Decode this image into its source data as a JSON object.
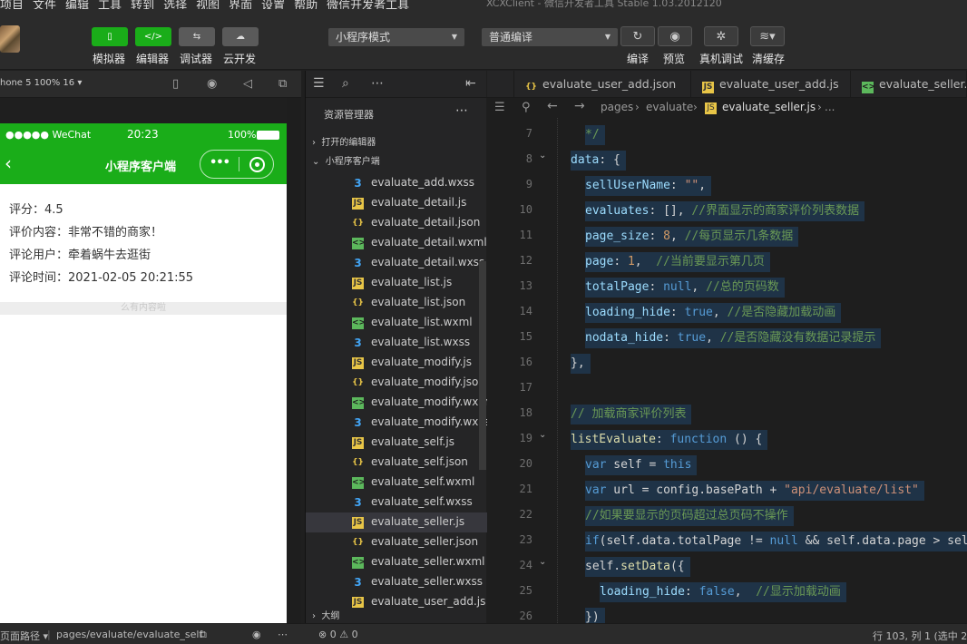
{
  "window": {
    "menus": [
      "项目",
      "文件",
      "编辑",
      "工具",
      "转到",
      "选择",
      "视图",
      "界面",
      "设置",
      "帮助",
      "微信开发者工具"
    ],
    "title": "XCXClient - 微信开发者工具 Stable 1.03.2012120"
  },
  "toolbar": {
    "buttons": [
      {
        "label": "模拟器",
        "glyph": "▯"
      },
      {
        "label": "编辑器",
        "glyph": "</>"
      },
      {
        "label": "调试器",
        "glyph": "⇆"
      },
      {
        "label": "云开发",
        "glyph": "☁"
      }
    ],
    "mode_select": "小程序模式",
    "compile_select": "普通编译",
    "right_buttons": [
      {
        "label": "编译",
        "glyph": "↻"
      },
      {
        "label": "预览",
        "glyph": "◉"
      },
      {
        "label": "真机调试",
        "glyph": "✲"
      },
      {
        "label": "清缓存",
        "glyph": "≋▾"
      }
    ]
  },
  "simulator": {
    "device": "hone 5 100% 16 ▾",
    "statusbar": {
      "carrier": "●●●●● WeChat",
      "time": "20:23",
      "battery": "100%"
    },
    "nav_title": "小程序客户端",
    "lines": [
      "评分：4.5",
      "评价内容：非常不错的商家！",
      "评论用户：牵着蜗牛去逛街",
      "评论时间：2021-02-05 20:21:55"
    ],
    "nodata": "么有内容啦"
  },
  "explorer": {
    "title": "资源管理器",
    "open_editors": "打开的编辑器",
    "project": "小程序客户端",
    "outline": "大纲",
    "files": [
      {
        "name": "evaluate_add.wxss",
        "type": "wxss"
      },
      {
        "name": "evaluate_detail.js",
        "type": "js"
      },
      {
        "name": "evaluate_detail.json",
        "type": "json"
      },
      {
        "name": "evaluate_detail.wxml",
        "type": "wxml"
      },
      {
        "name": "evaluate_detail.wxss",
        "type": "wxss"
      },
      {
        "name": "evaluate_list.js",
        "type": "js"
      },
      {
        "name": "evaluate_list.json",
        "type": "json"
      },
      {
        "name": "evaluate_list.wxml",
        "type": "wxml"
      },
      {
        "name": "evaluate_list.wxss",
        "type": "wxss"
      },
      {
        "name": "evaluate_modify.js",
        "type": "js"
      },
      {
        "name": "evaluate_modify.json",
        "type": "json"
      },
      {
        "name": "evaluate_modify.wxml",
        "type": "wxml"
      },
      {
        "name": "evaluate_modify.wxss",
        "type": "wxss"
      },
      {
        "name": "evaluate_self.js",
        "type": "js"
      },
      {
        "name": "evaluate_self.json",
        "type": "json"
      },
      {
        "name": "evaluate_self.wxml",
        "type": "wxml"
      },
      {
        "name": "evaluate_self.wxss",
        "type": "wxss"
      },
      {
        "name": "evaluate_seller.js",
        "type": "js",
        "active": true
      },
      {
        "name": "evaluate_seller.json",
        "type": "json"
      },
      {
        "name": "evaluate_seller.wxml",
        "type": "wxml"
      },
      {
        "name": "evaluate_seller.wxss",
        "type": "wxss"
      },
      {
        "name": "evaluate_user_add.js",
        "type": "js"
      }
    ]
  },
  "editor": {
    "tabs": [
      {
        "name": "evaluate_user_add.json",
        "type": "json"
      },
      {
        "name": "evaluate_user_add.js",
        "type": "js"
      },
      {
        "name": "evaluate_seller.wxml",
        "type": "wxml"
      }
    ],
    "breadcrumb": [
      "pages",
      "evaluate",
      "evaluate_seller.js",
      "..."
    ],
    "lines": [
      {
        "no": "7",
        "fold": "",
        "indent": 1,
        "tokens": [
          [
            "c",
            "*/"
          ]
        ]
      },
      {
        "no": "8",
        "fold": "⌄",
        "indent": 0,
        "tokens": [
          [
            "p",
            "data"
          ],
          [
            "o",
            ": {"
          ]
        ]
      },
      {
        "no": "9",
        "fold": "",
        "indent": 1,
        "tokens": [
          [
            "p",
            "sellUserName"
          ],
          [
            "o",
            ": "
          ],
          [
            "s",
            "\"\""
          ],
          [
            "o",
            ","
          ]
        ]
      },
      {
        "no": "10",
        "fold": "",
        "indent": 1,
        "tokens": [
          [
            "p",
            "evaluates"
          ],
          [
            "o",
            ": [], "
          ],
          [
            "c",
            "//界面显示的商家评价列表数据"
          ]
        ]
      },
      {
        "no": "11",
        "fold": "",
        "indent": 1,
        "tokens": [
          [
            "p",
            "page_size"
          ],
          [
            "o",
            ": "
          ],
          [
            "n",
            "8"
          ],
          [
            "o",
            ", "
          ],
          [
            "c",
            "//每页显示几条数据"
          ]
        ]
      },
      {
        "no": "12",
        "fold": "",
        "indent": 1,
        "tokens": [
          [
            "p",
            "page"
          ],
          [
            "o",
            ": "
          ],
          [
            "n",
            "1"
          ],
          [
            "o",
            ",  "
          ],
          [
            "c",
            "//当前要显示第几页"
          ]
        ]
      },
      {
        "no": "13",
        "fold": "",
        "indent": 1,
        "tokens": [
          [
            "p",
            "totalPage"
          ],
          [
            "o",
            ": "
          ],
          [
            "k",
            "null"
          ],
          [
            "o",
            ", "
          ],
          [
            "c",
            "//总的页码数"
          ]
        ]
      },
      {
        "no": "14",
        "fold": "",
        "indent": 1,
        "tokens": [
          [
            "p",
            "loading_hide"
          ],
          [
            "o",
            ": "
          ],
          [
            "k",
            "true"
          ],
          [
            "o",
            ", "
          ],
          [
            "c",
            "//是否隐藏加载动画"
          ]
        ]
      },
      {
        "no": "15",
        "fold": "",
        "indent": 1,
        "tokens": [
          [
            "p",
            "nodata_hide"
          ],
          [
            "o",
            ": "
          ],
          [
            "k",
            "true"
          ],
          [
            "o",
            ", "
          ],
          [
            "c",
            "//是否隐藏没有数据记录提示"
          ]
        ]
      },
      {
        "no": "16",
        "fold": "",
        "indent": 0,
        "tokens": [
          [
            "o",
            "},"
          ]
        ]
      },
      {
        "no": "17",
        "fold": "",
        "indent": 0,
        "tokens": []
      },
      {
        "no": "18",
        "fold": "",
        "indent": 0,
        "tokens": [
          [
            "c",
            "// 加载商家评价列表"
          ]
        ]
      },
      {
        "no": "19",
        "fold": "⌄",
        "indent": 0,
        "tokens": [
          [
            "f",
            "listEvaluate"
          ],
          [
            "o",
            ": "
          ],
          [
            "k",
            "function"
          ],
          [
            "o",
            " () {"
          ]
        ]
      },
      {
        "no": "20",
        "fold": "",
        "indent": 1,
        "tokens": [
          [
            "k",
            "var"
          ],
          [
            "o",
            " self = "
          ],
          [
            "k",
            "this"
          ]
        ]
      },
      {
        "no": "21",
        "fold": "",
        "indent": 1,
        "tokens": [
          [
            "k",
            "var"
          ],
          [
            "o",
            " url = config.basePath + "
          ],
          [
            "s",
            "\"api/evaluate/list\""
          ]
        ]
      },
      {
        "no": "22",
        "fold": "",
        "indent": 1,
        "tokens": [
          [
            "c",
            "//如果要显示的页码超过总页码不操作"
          ]
        ]
      },
      {
        "no": "23",
        "fold": "",
        "indent": 1,
        "tokens": [
          [
            "k",
            "if"
          ],
          [
            "o",
            "(self.data.totalPage != "
          ],
          [
            "k",
            "null"
          ],
          [
            "o",
            " && self.data.page > self"
          ]
        ]
      },
      {
        "no": "24",
        "fold": "⌄",
        "indent": 1,
        "tokens": [
          [
            "o",
            "self."
          ],
          [
            "f",
            "setData"
          ],
          [
            "o",
            "({"
          ]
        ]
      },
      {
        "no": "25",
        "fold": "",
        "indent": 2,
        "tokens": [
          [
            "p",
            "loading_hide"
          ],
          [
            "o",
            ": "
          ],
          [
            "k",
            "false"
          ],
          [
            "o",
            ",  "
          ],
          [
            "c",
            "//显示加载动画"
          ]
        ]
      },
      {
        "no": "26",
        "fold": "",
        "indent": 1,
        "tokens": [
          [
            "o",
            "})"
          ]
        ]
      }
    ]
  },
  "statusbar": {
    "path_label": "页面路径 ▾",
    "path": "pages/evaluate/evaluate_self",
    "problems": "⊗ 0 ⚠ 0",
    "position": "行 103, 列 1 (选中 2"
  }
}
